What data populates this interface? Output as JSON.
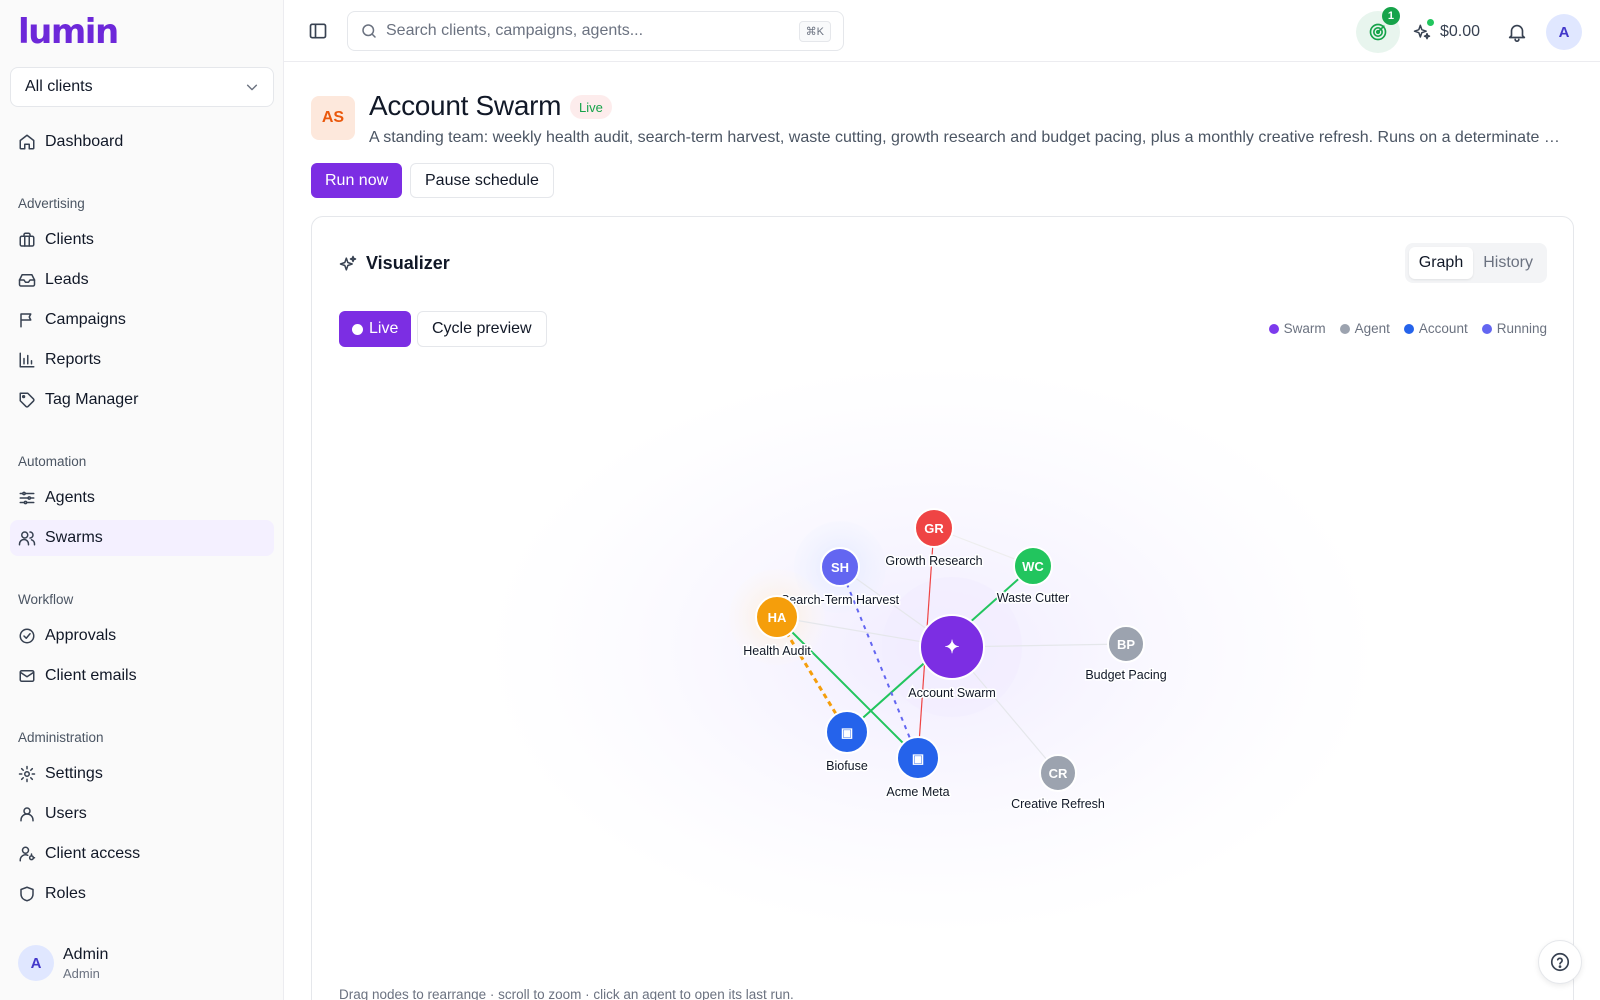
{
  "app": {
    "logo_text": "lumin",
    "accent": "#7c2ee3"
  },
  "sidebar": {
    "client_select": "All clients",
    "top_item": {
      "label": "Dashboard",
      "icon": "home-icon"
    },
    "sections": [
      {
        "title": "Advertising",
        "items": [
          {
            "label": "Clients",
            "icon": "briefcase-icon"
          },
          {
            "label": "Leads",
            "icon": "inbox-icon"
          },
          {
            "label": "Campaigns",
            "icon": "flag-icon"
          },
          {
            "label": "Reports",
            "icon": "bar-chart-icon"
          },
          {
            "label": "Tag Manager",
            "icon": "tag-icon"
          }
        ]
      },
      {
        "title": "Automation",
        "items": [
          {
            "label": "Agents",
            "icon": "sliders-icon"
          },
          {
            "label": "Swarms",
            "icon": "users-icon",
            "active": true
          }
        ]
      },
      {
        "title": "Workflow",
        "items": [
          {
            "label": "Approvals",
            "icon": "check-circle-icon"
          },
          {
            "label": "Client emails",
            "icon": "mail-icon"
          }
        ]
      },
      {
        "title": "Administration",
        "items": [
          {
            "label": "Settings",
            "icon": "gear-icon"
          },
          {
            "label": "Users",
            "icon": "user-icon"
          },
          {
            "label": "Client access",
            "icon": "user-key-icon"
          },
          {
            "label": "Roles",
            "icon": "shield-icon"
          }
        ]
      }
    ],
    "user": {
      "initial": "A",
      "name": "Admin",
      "role": "Admin"
    }
  },
  "topbar": {
    "search_placeholder": "Search clients, campaigns, agents...",
    "shortcut": "⌘K",
    "notif_count": "1",
    "cost": "$0.00",
    "avatar_initial": "A"
  },
  "header": {
    "avatar": "AS",
    "title": "Account Swarm",
    "status": "Live",
    "description": "A standing team: weekly health audit, search-term harvest, waste cutting, growth research and budget pacing, plus a monthly creative refresh. Runs on a determinate schedule.",
    "run_label": "Run now",
    "pause_label": "Pause schedule"
  },
  "visualizer": {
    "title": "Visualizer",
    "views": [
      "Graph",
      "History"
    ],
    "active_view": "Graph",
    "live_label": "Live",
    "cycle_label": "Cycle preview",
    "legend": [
      {
        "label": "Swarm",
        "color": "#7c3aed"
      },
      {
        "label": "Agent",
        "color": "#9ca3af"
      },
      {
        "label": "Account",
        "color": "#2563eb"
      },
      {
        "label": "Running",
        "color": "#6366f1"
      }
    ],
    "hint": "Drag nodes to rearrange · scroll to zoom · click an agent to open its last run.",
    "nodes": [
      {
        "id": "swarm",
        "label": "Account Swarm",
        "kind": "swarm",
        "glyph": "✦",
        "color": "#7c2ee3"
      },
      {
        "id": "gr",
        "label": "Growth Research",
        "kind": "agent",
        "initials": "GR",
        "color": "#ef4444"
      },
      {
        "id": "sh",
        "label": "Search-Term Harvest",
        "kind": "agent",
        "initials": "SH",
        "color": "#6366f1"
      },
      {
        "id": "wc",
        "label": "Waste Cutter",
        "kind": "agent",
        "initials": "WC",
        "color": "#22c55e"
      },
      {
        "id": "ha",
        "label": "Health Audit",
        "kind": "agent",
        "initials": "HA",
        "color": "#f59e0b"
      },
      {
        "id": "bp",
        "label": "Budget Pacing",
        "kind": "agent",
        "initials": "BP",
        "color": "#9ca3af"
      },
      {
        "id": "cr",
        "label": "Creative Refresh",
        "kind": "agent",
        "initials": "CR",
        "color": "#9ca3af"
      },
      {
        "id": "biofuse",
        "label": "Biofuse",
        "kind": "account",
        "glyph": "▣",
        "color": "#2563eb"
      },
      {
        "id": "acme",
        "label": "Acme Meta",
        "kind": "account",
        "glyph": "▣",
        "color": "#2563eb"
      }
    ],
    "edges": [
      {
        "from": "gr",
        "to": "acme",
        "color": "#ef4444",
        "style": "solid"
      },
      {
        "from": "wc",
        "to": "biofuse",
        "color": "#22c55e",
        "style": "solid"
      },
      {
        "from": "ha",
        "to": "acme",
        "color": "#22c55e",
        "style": "solid"
      },
      {
        "from": "sh",
        "to": "acme",
        "color": "#6366f1",
        "style": "dashed"
      },
      {
        "from": "ha",
        "to": "biofuse",
        "color": "#f59e0b",
        "style": "dashed"
      },
      {
        "from": "swarm",
        "to": "bp",
        "color": "#e5e7eb",
        "style": "solid"
      },
      {
        "from": "swarm",
        "to": "cr",
        "color": "#e5e7eb",
        "style": "solid"
      },
      {
        "from": "swarm",
        "to": "ha",
        "color": "#e5e7eb",
        "style": "solid"
      },
      {
        "from": "swarm",
        "to": "sh",
        "color": "#e5e7eb",
        "style": "solid"
      },
      {
        "from": "gr",
        "to": "wc",
        "color": "#eeeeee",
        "style": "solid"
      }
    ]
  }
}
